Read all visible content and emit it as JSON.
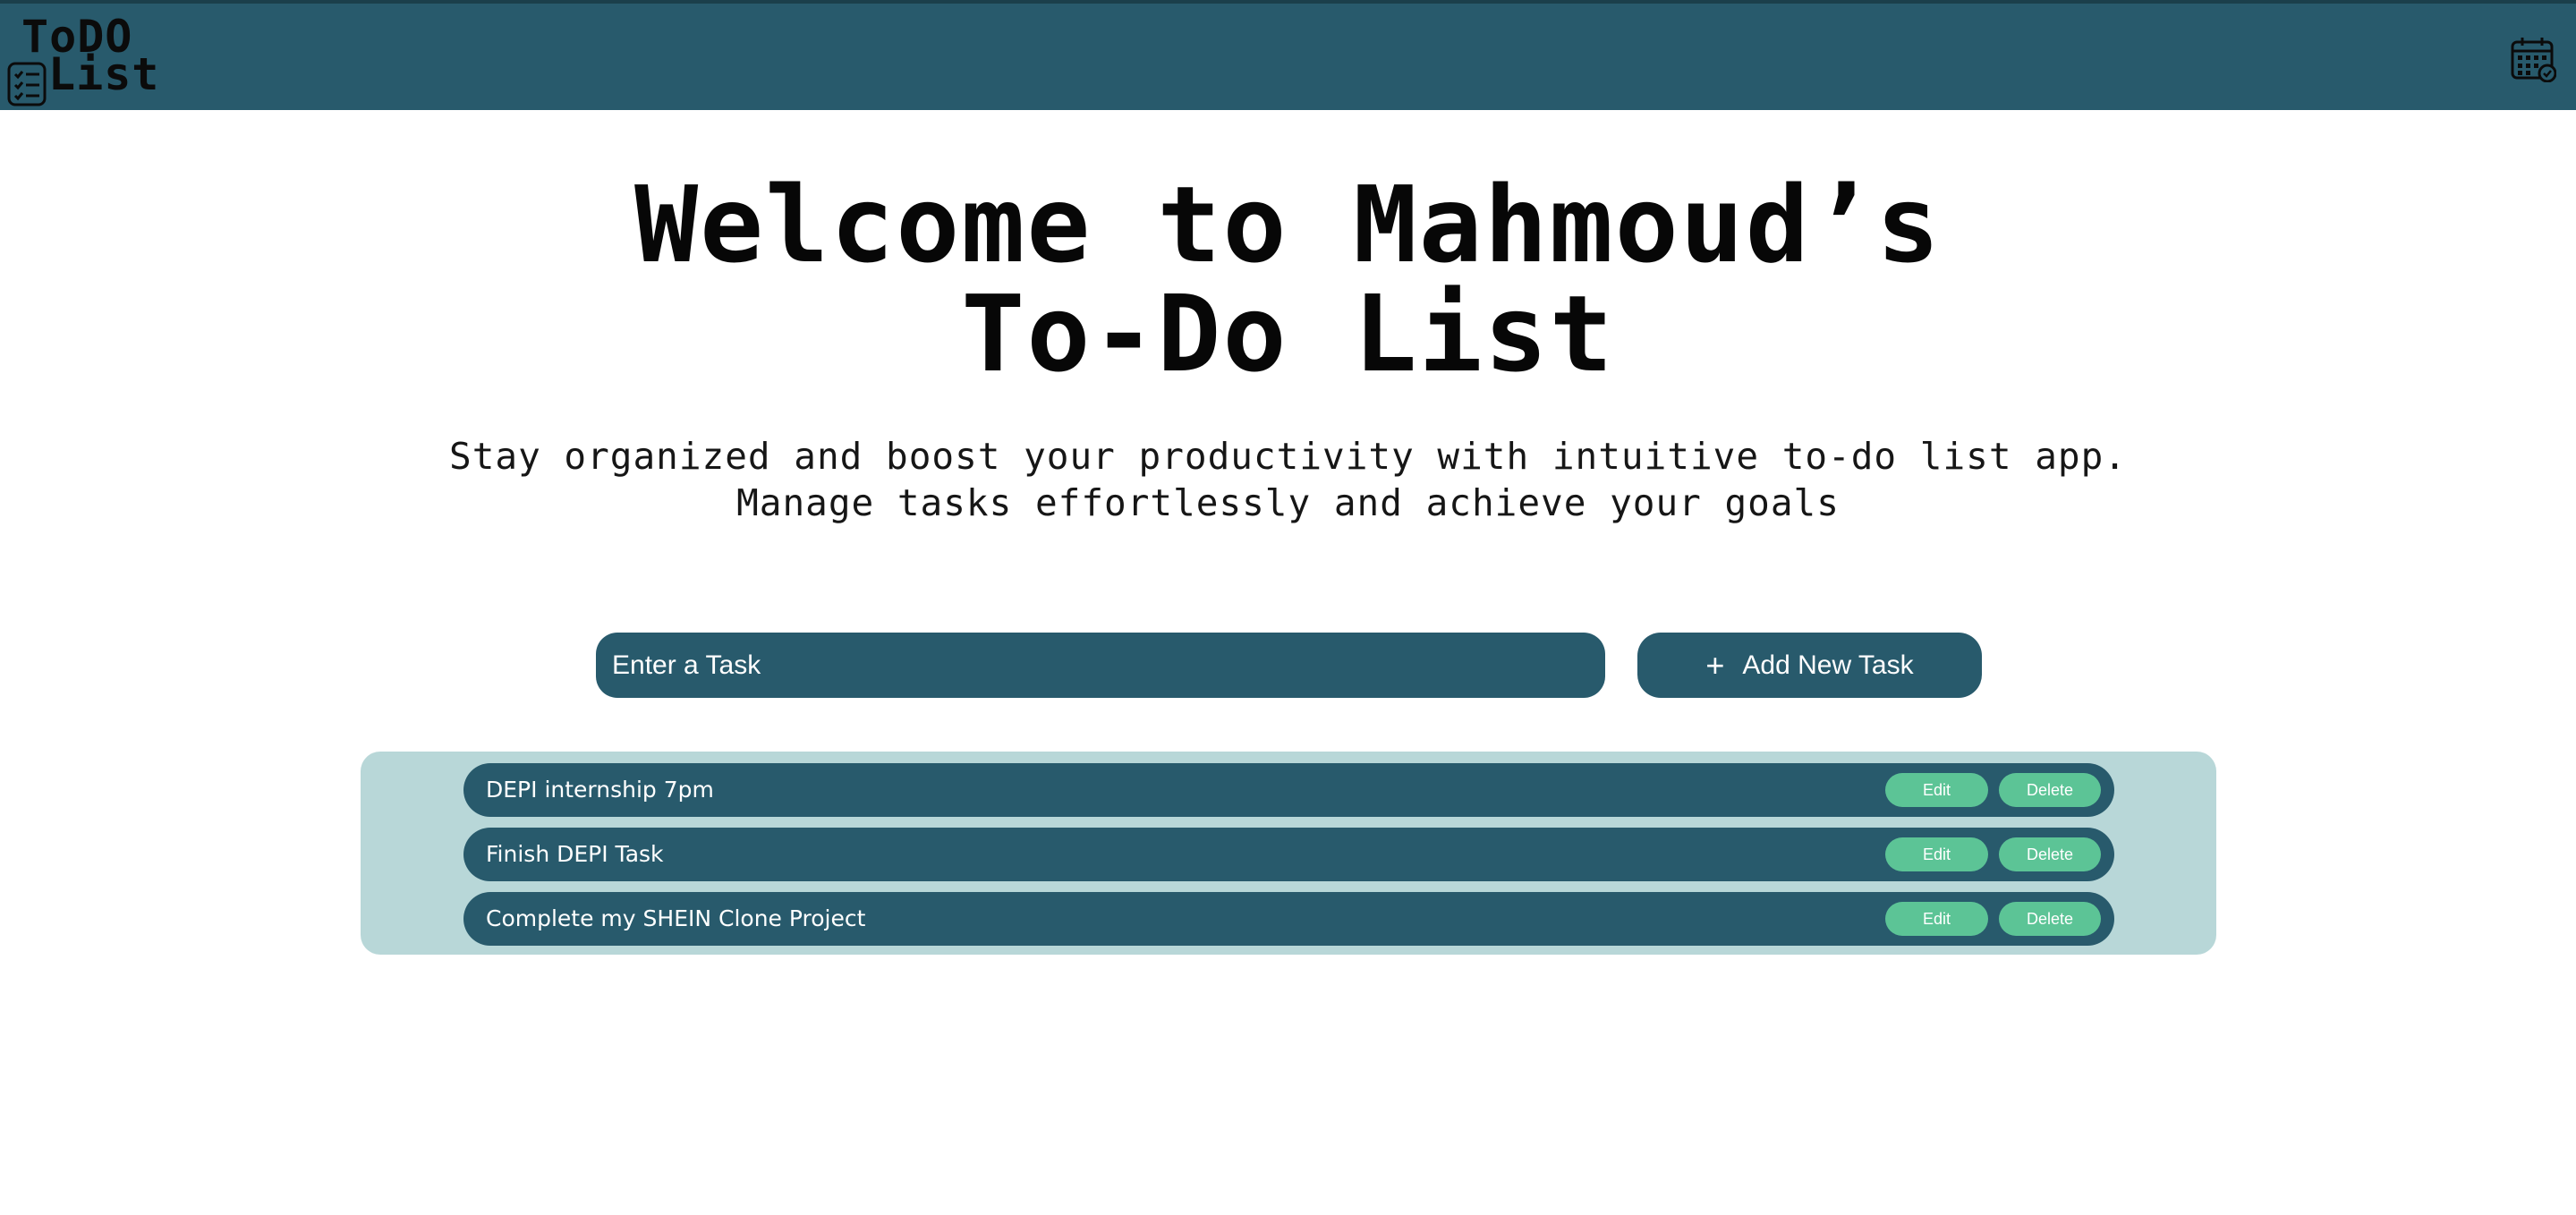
{
  "header": {
    "logo_line1": "ToDO",
    "logo_line2": "List",
    "logo_icon": "checklist-icon",
    "calendar_icon": "calendar-check-icon"
  },
  "hero": {
    "title_line1": "Welcome to Mahmoud’s",
    "title_line2": "To-Do List",
    "subtitle_line1": "Stay organized and boost your productivity with intuitive to-do list app.",
    "subtitle_line2": "Manage tasks effortlessly and achieve your goals"
  },
  "form": {
    "placeholder": "Enter a Task",
    "add_icon": "plus-icon",
    "add_label": "Add New Task"
  },
  "tasks": [
    {
      "text": "DEPI internship 7pm",
      "edit_label": "Edit",
      "delete_label": "Delete"
    },
    {
      "text": "Finish DEPI Task",
      "edit_label": "Edit",
      "delete_label": "Delete"
    },
    {
      "text": "Complete my SHEIN Clone Project",
      "edit_label": "Edit",
      "delete_label": "Delete"
    }
  ],
  "colors": {
    "primary": "#285a6c",
    "list_background": "#b8d7d8",
    "action_button": "#5cc496"
  }
}
